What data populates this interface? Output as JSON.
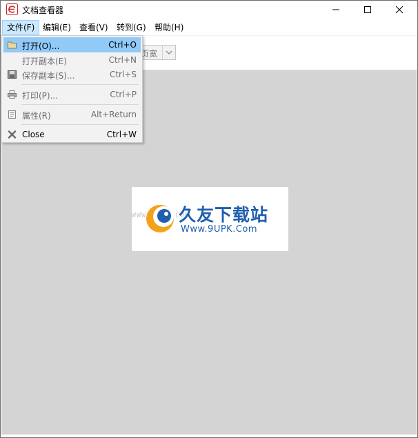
{
  "window": {
    "title": "文档查看器",
    "app_icon": "e-logo-icon",
    "controls": [
      "minimize-icon",
      "maximize-icon",
      "close-icon"
    ]
  },
  "menubar": {
    "items": [
      {
        "label": "文件(F)",
        "active": true
      },
      {
        "label": "编辑(E)"
      },
      {
        "label": "查看(V)"
      },
      {
        "label": "转到(G)"
      },
      {
        "label": "帮助(H)"
      }
    ]
  },
  "toolbar": {
    "zoom_value": "页宽"
  },
  "file_menu": {
    "items": [
      {
        "icon": "folder-open-icon",
        "label": "打开(O)...",
        "shortcut": "Ctrl+O",
        "enabled": true,
        "highlighted": true
      },
      {
        "icon": "",
        "label": "打开副本(E)",
        "shortcut": "Ctrl+N",
        "enabled": false
      },
      {
        "icon": "save-icon",
        "label": "保存副本(S)...",
        "shortcut": "Ctrl+S",
        "enabled": false
      },
      {
        "icon": "printer-icon",
        "label": "打印(P)...",
        "shortcut": "Ctrl+P",
        "enabled": false
      },
      {
        "icon": "properties-icon",
        "label": "属性(R)",
        "shortcut": "Alt+Return",
        "enabled": false
      },
      {
        "icon": "close-x-icon",
        "label": "Close",
        "shortcut": "Ctrl+W",
        "enabled": true
      }
    ]
  },
  "watermark": {
    "brand": "久友下载站",
    "url": "Www.9UPK.Com",
    "faint": "WWW.9UPK.COM",
    "colors": {
      "brand": "#1f5fae",
      "logo_orange": "#f4a21a"
    }
  },
  "colors": {
    "viewport_bg": "#d4d4d4",
    "menu_highlight": "#91c9f7",
    "menubar_active": "#cce8ff"
  }
}
